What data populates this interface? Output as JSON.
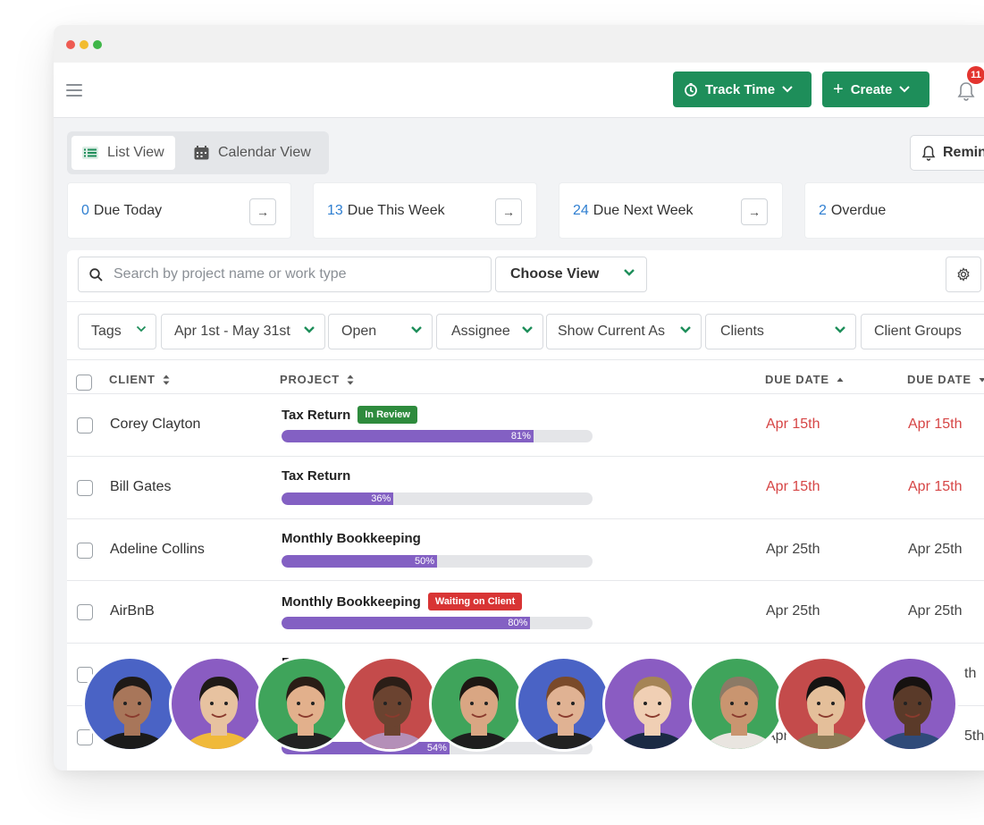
{
  "colors": {
    "green": "#1e8e5a",
    "blue": "#2f7fd1",
    "red": "#d64545",
    "purple": "#8360c3",
    "tag_green": "#2e8b3d",
    "tag_red": "#d83434"
  },
  "header": {
    "track_time": "Track Time",
    "create": "Create",
    "notifications_count": "11"
  },
  "toolbar": {
    "list_view": "List View",
    "calendar_view": "Calendar View",
    "reminders": "Remin"
  },
  "due_cards": [
    {
      "count": "0",
      "label": "Due Today"
    },
    {
      "count": "13",
      "label": "Due This Week"
    },
    {
      "count": "24",
      "label": "Due Next Week"
    },
    {
      "count": "2",
      "label": "Overdue"
    }
  ],
  "search": {
    "placeholder": "Search by project name or work type"
  },
  "choose_view": "Choose View",
  "filters": [
    "Tags",
    "Apr 1st - May 31st",
    "Open",
    "Assignee",
    "Show Current As",
    "Clients",
    "Client Groups"
  ],
  "table": {
    "headers": {
      "client": "CLIENT",
      "project": "PROJECT",
      "due_date_1": "DUE DATE",
      "due_date_2": "DUE DATE"
    },
    "rows": [
      {
        "client": "Corey Clayton",
        "project": "Tax Return",
        "tag": "In Review",
        "tag_type": "green",
        "progress": 81,
        "progress_label": "81%",
        "due1": "Apr 15th",
        "due2": "Apr 15th",
        "overdue": true
      },
      {
        "client": "Bill Gates",
        "project": "Tax Return",
        "tag": "",
        "tag_type": "",
        "progress": 36,
        "progress_label": "36%",
        "due1": "Apr 15th",
        "due2": "Apr 15th",
        "overdue": true
      },
      {
        "client": "Adeline Collins",
        "project": "Monthly Bookkeeping",
        "tag": "",
        "tag_type": "",
        "progress": 50,
        "progress_label": "50%",
        "due1": "Apr 25th",
        "due2": "Apr 25th",
        "overdue": false
      },
      {
        "client": "AirBnB",
        "project": "Monthly Bookkeeping",
        "tag": "Waiting on Client",
        "tag_type": "red",
        "progress": 80,
        "progress_label": "80%",
        "due1": "Apr 25th",
        "due2": "Apr 25th",
        "overdue": false
      },
      {
        "client": "",
        "project": "Bo",
        "tag": "",
        "tag_type": "",
        "progress": null,
        "progress_label": "",
        "due1": "",
        "due2": "th",
        "overdue": false
      },
      {
        "client": "",
        "project": "",
        "tag": "",
        "tag_type": "",
        "progress": 54,
        "progress_label": "54%",
        "due1": "Apr",
        "due2": "5th",
        "overdue": false
      }
    ]
  },
  "avatars": [
    {
      "bg": "#4a63c5",
      "skin": "#a8765a",
      "hair": "#1f1a17",
      "shirt": "#1b1b1b"
    },
    {
      "bg": "#8a5cc2",
      "skin": "#e7c2a0",
      "hair": "#1f1a17",
      "shirt": "#f0b93a"
    },
    {
      "bg": "#3fa45b",
      "skin": "#e2b08c",
      "hair": "#2a1d16",
      "shirt": "#222222"
    },
    {
      "bg": "#c44b4b",
      "skin": "#6b4330",
      "hair": "#2b1e17",
      "shirt": "#b48fb8"
    },
    {
      "bg": "#3fa45b",
      "skin": "#d9a683",
      "hair": "#1e1713",
      "shirt": "#1e1e1e"
    },
    {
      "bg": "#4a63c5",
      "skin": "#e0b293",
      "hair": "#7a4a2a",
      "shirt": "#222222"
    },
    {
      "bg": "#8a5cc2",
      "skin": "#f0cfb4",
      "hair": "#a58456",
      "shirt": "#1b2a44"
    },
    {
      "bg": "#3fa45b",
      "skin": "#c99570",
      "hair": "#8c7a66",
      "shirt": "#e9e5e0"
    },
    {
      "bg": "#c44b4b",
      "skin": "#e4bf9a",
      "hair": "#151312",
      "shirt": "#8c7a55"
    },
    {
      "bg": "#8a5cc2",
      "skin": "#5a3a29",
      "hair": "#161210",
      "shirt": "#2f4a79"
    }
  ]
}
